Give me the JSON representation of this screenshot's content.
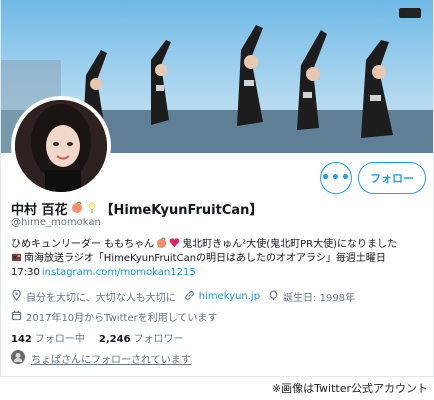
{
  "profile": {
    "display_name": "中村 百花",
    "group_tag": "【HimeKyunFruitCan】",
    "handle": "@hime_momokan",
    "bio_line1": "ひめキュンリーダー ももちゃん",
    "bio_line1_rest": "鬼北町きゅん²大使(鬼北町PR大使)になりました",
    "bio_line2": "南海放送ラジオ「HimeKyunFruitCanの明日はあしたのオオアラシ」毎週土曜日",
    "bio_line3_time": "17:30",
    "bio_line3_link": "instagram.com/momokan1215",
    "location": "自分を大切に、大切な人も大切に",
    "website": "himekyun.jp",
    "birthday": "誕生日: 1998年",
    "joined": "2017年10月からTwitterを利用しています",
    "following_count": "142",
    "following_label": "フォロー中",
    "followers_count": "2,246",
    "followers_label": "フォロワー",
    "followed_by": "ちょぱさんにフォローされています"
  },
  "actions": {
    "more_label": "•••",
    "follow_label": "フォロー"
  },
  "credit": "※画像はTwitter公式アカウント",
  "colors": {
    "accent": "#1da1f2",
    "link": "#1b95e0",
    "muted": "#657786"
  },
  "icons": [
    "more-icon",
    "location-icon",
    "link-icon",
    "balloon-icon",
    "calendar-icon",
    "peach-emoji",
    "flower-emoji",
    "heart-emoji",
    "radio-emoji"
  ]
}
